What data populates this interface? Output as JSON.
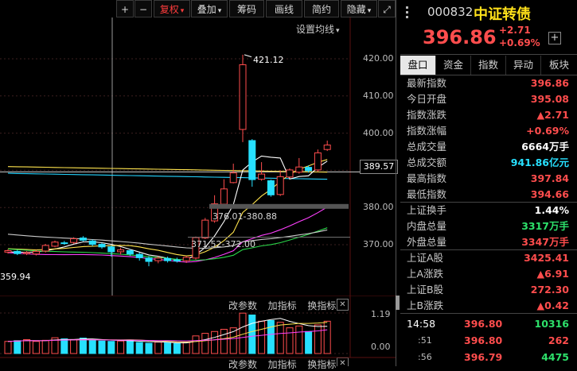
{
  "toolbar": {
    "buttons": [
      {
        "label": "+",
        "name": "zoom-in-button"
      },
      {
        "label": "−",
        "name": "zoom-out-button"
      },
      {
        "label": "复权",
        "name": "adjust-dropdown"
      },
      {
        "label": "叠加",
        "name": "overlay-dropdown"
      },
      {
        "label": "筹码",
        "name": "chips-button"
      },
      {
        "label": "画线",
        "name": "draw-line-button"
      },
      {
        "label": "简约",
        "name": "simple-mode-button"
      },
      {
        "label": "隐藏",
        "name": "hide-dropdown"
      }
    ],
    "dropdown_arrow": "▾",
    "expand_icon": "⤢"
  },
  "chart": {
    "ma_setting": "设置均线",
    "price_axis": [
      "420.00",
      "410.00",
      "400.00",
      "390.00",
      "380.00",
      "370.00"
    ],
    "current_price_tag": "389.57",
    "high_label": "421.12",
    "low_label": "359.94",
    "range_label_1": "376.01-380.88",
    "range_label_2": "371.52-372.00",
    "indicator_controls": [
      "改参数",
      "加指标",
      "换指标"
    ],
    "volume_axis": [
      "1.19",
      "0.00"
    ],
    "close_icon": "✕"
  },
  "chart_data": {
    "type": "candlestick",
    "ylim": [
      355,
      425
    ],
    "candles": [
      {
        "o": 368.0,
        "c": 368.4,
        "h": 368.8,
        "l": 367.6
      },
      {
        "o": 368.2,
        "c": 367.6,
        "h": 368.6,
        "l": 367.2
      },
      {
        "o": 367.6,
        "c": 367.9,
        "h": 368.3,
        "l": 367.2
      },
      {
        "o": 367.5,
        "c": 368.2,
        "h": 368.6,
        "l": 367.1
      },
      {
        "o": 368.3,
        "c": 369.8,
        "h": 370.2,
        "l": 367.9
      },
      {
        "o": 369.6,
        "c": 370.7,
        "h": 371.1,
        "l": 369.3
      },
      {
        "o": 370.5,
        "c": 370.4,
        "h": 371.0,
        "l": 370.0
      },
      {
        "o": 370.6,
        "c": 371.6,
        "h": 372.0,
        "l": 370.2
      },
      {
        "o": 371.8,
        "c": 371.2,
        "h": 372.3,
        "l": 370.9
      },
      {
        "o": 371.0,
        "c": 370.1,
        "h": 371.4,
        "l": 369.6
      },
      {
        "o": 370.1,
        "c": 369.4,
        "h": 370.5,
        "l": 368.9
      },
      {
        "o": 369.4,
        "c": 368.1,
        "h": 369.8,
        "l": 366.8
      },
      {
        "o": 368.1,
        "c": 368.6,
        "h": 369.2,
        "l": 367.3
      },
      {
        "o": 368.4,
        "c": 367.5,
        "h": 368.8,
        "l": 367.0
      },
      {
        "o": 367.4,
        "c": 366.5,
        "h": 367.9,
        "l": 365.7
      },
      {
        "o": 366.4,
        "c": 365.5,
        "h": 366.9,
        "l": 364.2
      },
      {
        "o": 365.7,
        "c": 366.4,
        "h": 366.9,
        "l": 365.0
      },
      {
        "o": 366.3,
        "c": 365.7,
        "h": 366.8,
        "l": 365.2
      },
      {
        "o": 365.9,
        "c": 365.6,
        "h": 366.5,
        "l": 365.2
      },
      {
        "o": 365.7,
        "c": 366.6,
        "h": 367.0,
        "l": 365.1
      },
      {
        "o": 366.4,
        "c": 371.9,
        "h": 372.2,
        "l": 366.0
      },
      {
        "o": 371.8,
        "c": 376.6,
        "h": 377.2,
        "l": 371.5
      },
      {
        "o": 376.4,
        "c": 381.0,
        "h": 383.3,
        "l": 375.9
      },
      {
        "o": 380.9,
        "c": 385.0,
        "h": 387.6,
        "l": 380.6
      },
      {
        "o": 386.7,
        "c": 389.3,
        "h": 391.8,
        "l": 386.5
      },
      {
        "o": 401.0,
        "c": 418.4,
        "h": 421.1,
        "l": 397.6
      },
      {
        "o": 398.0,
        "c": 387.5,
        "h": 398.4,
        "l": 385.6
      },
      {
        "o": 387.6,
        "c": 389.0,
        "h": 392.2,
        "l": 387.2
      },
      {
        "o": 387.2,
        "c": 383.4,
        "h": 387.5,
        "l": 382.9
      },
      {
        "o": 383.5,
        "c": 388.3,
        "h": 390.0,
        "l": 383.1
      },
      {
        "o": 388.2,
        "c": 390.1,
        "h": 390.5,
        "l": 387.8
      },
      {
        "o": 389.5,
        "c": 390.9,
        "h": 393.3,
        "l": 389.1
      },
      {
        "o": 390.8,
        "c": 389.9,
        "h": 391.3,
        "l": 389.4
      },
      {
        "o": 390.1,
        "c": 394.7,
        "h": 395.6,
        "l": 389.6
      },
      {
        "o": 395.6,
        "c": 396.8,
        "h": 398.0,
        "l": 395.2
      }
    ],
    "volume": [
      0.33,
      0.35,
      0.38,
      0.33,
      0.36,
      0.43,
      0.4,
      0.38,
      0.42,
      0.36,
      0.34,
      0.33,
      0.34,
      0.37,
      0.3,
      0.28,
      0.31,
      0.29,
      0.27,
      0.3,
      0.48,
      0.55,
      0.6,
      0.66,
      0.7,
      1.1,
      1.05,
      0.88,
      0.9,
      0.85,
      0.7,
      0.75,
      0.6,
      0.78,
      0.88
    ]
  },
  "quote": {
    "code": "000832",
    "name": "中证转债",
    "price": "396.86",
    "change": "+2.71",
    "change_pct": "+0.69%",
    "add_icon": "+"
  },
  "tabs": [
    "盘口",
    "资金",
    "指数",
    "异动",
    "板块"
  ],
  "stats1": [
    {
      "k": "最新指数",
      "v": "396.86",
      "c": "red"
    },
    {
      "k": "今日开盘",
      "v": "395.08",
      "c": "red"
    },
    {
      "k": "指数涨跌",
      "v": "▲2.71",
      "c": "red"
    },
    {
      "k": "指数涨幅",
      "v": "+0.69%",
      "c": "red"
    },
    {
      "k": "总成交量",
      "v": "6664万手",
      "c": "white"
    },
    {
      "k": "总成交额",
      "v": "941.86亿元",
      "c": "cyan"
    },
    {
      "k": "最高指数",
      "v": "397.84",
      "c": "red"
    },
    {
      "k": "最低指数",
      "v": "394.66",
      "c": "red"
    }
  ],
  "stats2": [
    {
      "k": "上证换手",
      "v": "1.44%",
      "c": "white"
    },
    {
      "k": "内盘总量",
      "v": "3317万手",
      "c": "green"
    },
    {
      "k": "外盘总量",
      "v": "3347万手",
      "c": "red"
    }
  ],
  "stats3": [
    {
      "k": "上证A股",
      "v": "3425.41",
      "c": "red"
    },
    {
      "k": "上A涨跌",
      "v": "▲6.91",
      "c": "red"
    },
    {
      "k": "上证B股",
      "v": "272.30",
      "c": "red"
    },
    {
      "k": "上B涨跌",
      "v": "▲0.42",
      "c": "red"
    }
  ],
  "ticks": [
    {
      "t": "14:58",
      "p": "396.80",
      "v": "10316",
      "vc": "green"
    },
    {
      "t": ":51",
      "p": "396.80",
      "v": "262",
      "vc": "red"
    },
    {
      "t": ":56",
      "p": "396.79",
      "v": "4475",
      "vc": "green"
    }
  ]
}
